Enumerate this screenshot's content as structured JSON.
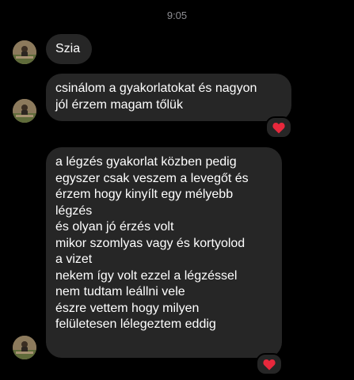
{
  "status_time": "9:05",
  "colors": {
    "background": "#000000",
    "bubble": "#262626",
    "text": "#ffffff",
    "timestamp": "#8e8e93",
    "heart": "#e8283c"
  },
  "messages": [
    {
      "lines": [
        "Szia"
      ],
      "reaction": null
    },
    {
      "lines": [
        "csinálom a gyakorlatokat és nagyon",
        "jól érzem magam tőlük"
      ],
      "reaction": "heart-icon"
    },
    {
      "lines": [
        "a légzés gyakorlat közben pedig",
        "egyszer csak veszem a levegőt és",
        "érzem hogy kinyílt egy mélyebb",
        "légzés",
        "és olyan jó érzés volt",
        "mikor szomlyas vagy és kortyolod",
        "a vizet",
        "nekem így volt ezzel a légzéssel",
        "nem tudtam leállni vele",
        "észre vettem hogy milyen",
        "felületesen lélegeztem eddig"
      ],
      "reaction": "heart-icon"
    }
  ]
}
